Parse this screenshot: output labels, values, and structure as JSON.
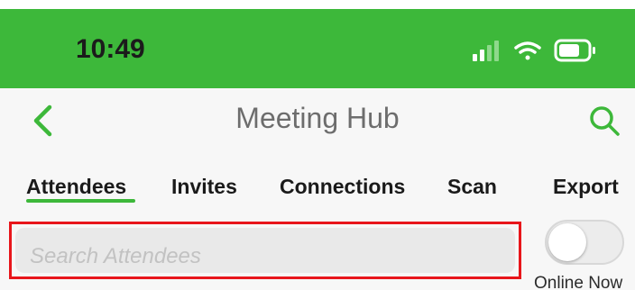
{
  "status_bar": {
    "time": "10:49",
    "background": "#3db83a",
    "icons": [
      "signal-icon",
      "wifi-icon",
      "battery-icon"
    ]
  },
  "nav": {
    "title": "Meeting Hub",
    "back_icon": "chevron-left-icon",
    "search_icon": "search-icon",
    "accent": "#3db83a"
  },
  "tabs": [
    {
      "label": "Attendees",
      "active": true
    },
    {
      "label": "Invites",
      "active": false
    },
    {
      "label": "Connections",
      "active": false
    },
    {
      "label": "Scan",
      "active": false
    },
    {
      "label": "Export",
      "active": false
    }
  ],
  "search": {
    "placeholder": "Search Attendees",
    "value": ""
  },
  "online_toggle": {
    "label": "Online Now",
    "on": false
  }
}
